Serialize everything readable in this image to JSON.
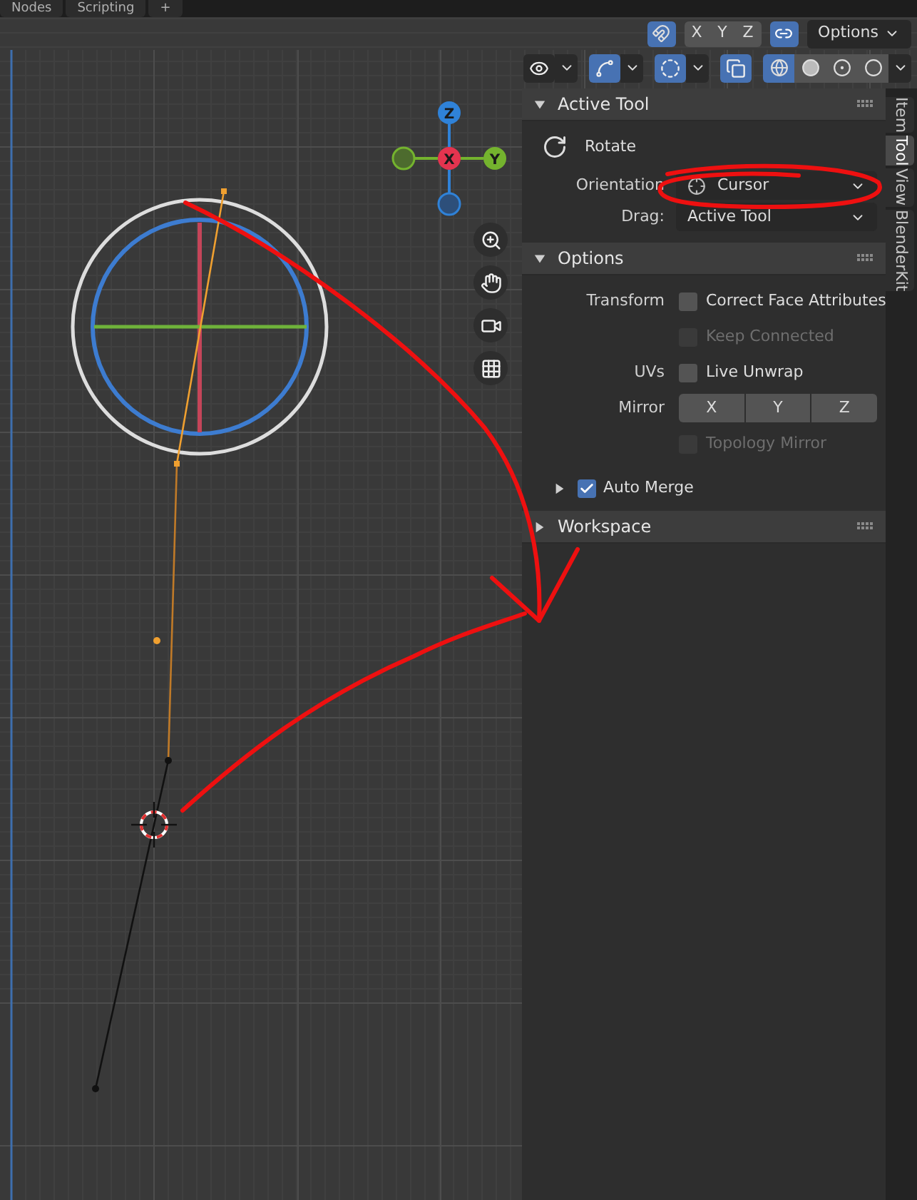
{
  "workspace_tabs": [
    {
      "label": "Nodes",
      "selected": false
    },
    {
      "label": "Scripting",
      "selected": false
    },
    {
      "label": "+",
      "selected": false
    }
  ],
  "header": {
    "snap_toggle": true,
    "mirror_axes": [
      {
        "label": "X",
        "selected": false
      },
      {
        "label": "Y",
        "selected": false
      },
      {
        "label": "Z",
        "selected": false
      }
    ],
    "mirror_link": true,
    "options_label": "Options"
  },
  "view_toggles": [
    {
      "kind": "visibility",
      "on": false
    },
    {
      "kind": "gizmo",
      "on": true
    },
    {
      "kind": "overlay",
      "on": true
    },
    {
      "kind": "xray",
      "on": true
    }
  ],
  "shading_modes": [
    {
      "kind": "wireframe",
      "selected": true
    },
    {
      "kind": "solid",
      "selected": false
    },
    {
      "kind": "material",
      "selected": false
    },
    {
      "kind": "rendered",
      "selected": false
    }
  ],
  "gizmo": {
    "axes": [
      {
        "label": "Z"
      },
      {
        "label": "X"
      },
      {
        "label": "Y"
      }
    ]
  },
  "active_tool": {
    "title": "Active Tool",
    "expanded": true,
    "tool_name": "Rotate",
    "orientation": {
      "label": "Orientation",
      "value": "Cursor"
    },
    "drag": {
      "label": "Drag:",
      "value": "Active Tool"
    }
  },
  "options": {
    "title": "Options",
    "expanded": true,
    "rows": [
      {
        "kind": "checkbox",
        "label": "Transform",
        "text": "Correct Face Attributes",
        "checked": false,
        "disabled": false
      },
      {
        "kind": "checkbox",
        "text": "Keep Connected",
        "checked": false,
        "disabled": true
      },
      {
        "kind": "checkbox",
        "label": "UVs",
        "text": "Live Unwrap",
        "checked": false,
        "disabled": false
      },
      {
        "kind": "buttons",
        "label": "Mirror",
        "buttons": [
          {
            "label": "X",
            "selected": false
          },
          {
            "label": "Y",
            "selected": false
          },
          {
            "label": "Z",
            "selected": false
          }
        ]
      },
      {
        "kind": "checkbox",
        "text": "Topology Mirror",
        "checked": false,
        "disabled": true
      }
    ],
    "auto_merge": {
      "text": "Auto Merge",
      "checked": true,
      "expanded": false
    }
  },
  "workspace": {
    "title": "Workspace",
    "expanded": false
  },
  "sidebar_tabs": [
    {
      "label": "Item",
      "selected": false
    },
    {
      "label": "Tool",
      "selected": true
    },
    {
      "label": "View",
      "selected": false
    },
    {
      "label": "BlenderKit",
      "selected": false
    }
  ]
}
